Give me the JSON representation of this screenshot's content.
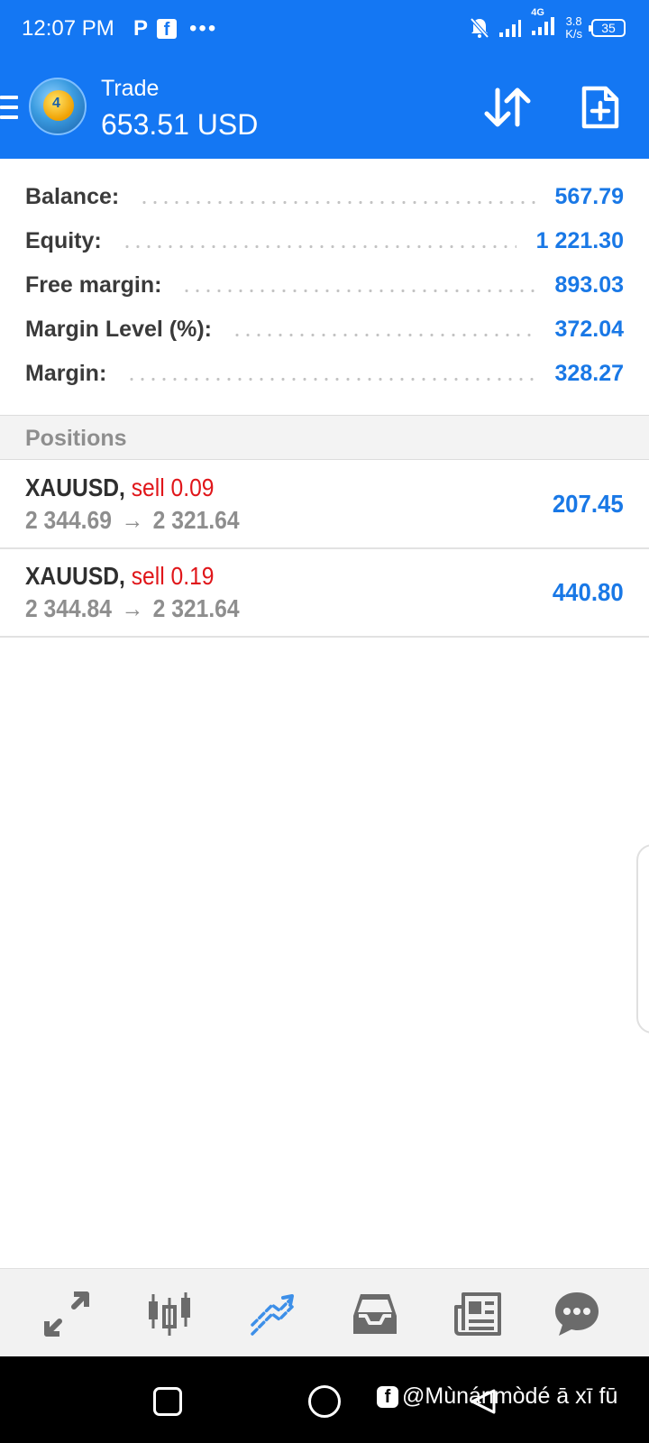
{
  "status_bar": {
    "time": "12:07 PM",
    "app_icons": [
      "P",
      "f",
      "•••"
    ],
    "network_type": "4G",
    "speed_value": "3.8",
    "speed_unit": "K/s",
    "battery": "35"
  },
  "header": {
    "title": "Trade",
    "amount": "653.51 USD"
  },
  "summary": [
    {
      "label": "Balance:",
      "value": "567.79"
    },
    {
      "label": "Equity:",
      "value": "1 221.30"
    },
    {
      "label": "Free margin:",
      "value": "893.03"
    },
    {
      "label": "Margin Level (%):",
      "value": "372.04"
    },
    {
      "label": "Margin:",
      "value": "328.27"
    }
  ],
  "positions_title": "Positions",
  "positions": [
    {
      "symbol": "XAUUSD,",
      "type": "sell 0.09",
      "open_price": "2 344.69",
      "arrow": "→",
      "current_price": "2 321.64",
      "profit": "207.45"
    },
    {
      "symbol": "XAUUSD,",
      "type": "sell 0.19",
      "open_price": "2 344.84",
      "arrow": "→",
      "current_price": "2 321.64",
      "profit": "440.80"
    }
  ],
  "bottom_nav": [
    "quotes-icon",
    "chart-icon",
    "trade-icon",
    "history-icon",
    "news-icon",
    "chat-icon"
  ],
  "watermark": {
    "icon": "f",
    "text": "@Mùnánmòdé ā xī fū"
  },
  "colors": {
    "primary": "#1477f3",
    "value_blue": "#1978e6",
    "sell_red": "#e0161a",
    "label_dark": "#3a3a3a",
    "muted_gray": "#8e8e8e",
    "active_nav": "#3d8fe8"
  }
}
